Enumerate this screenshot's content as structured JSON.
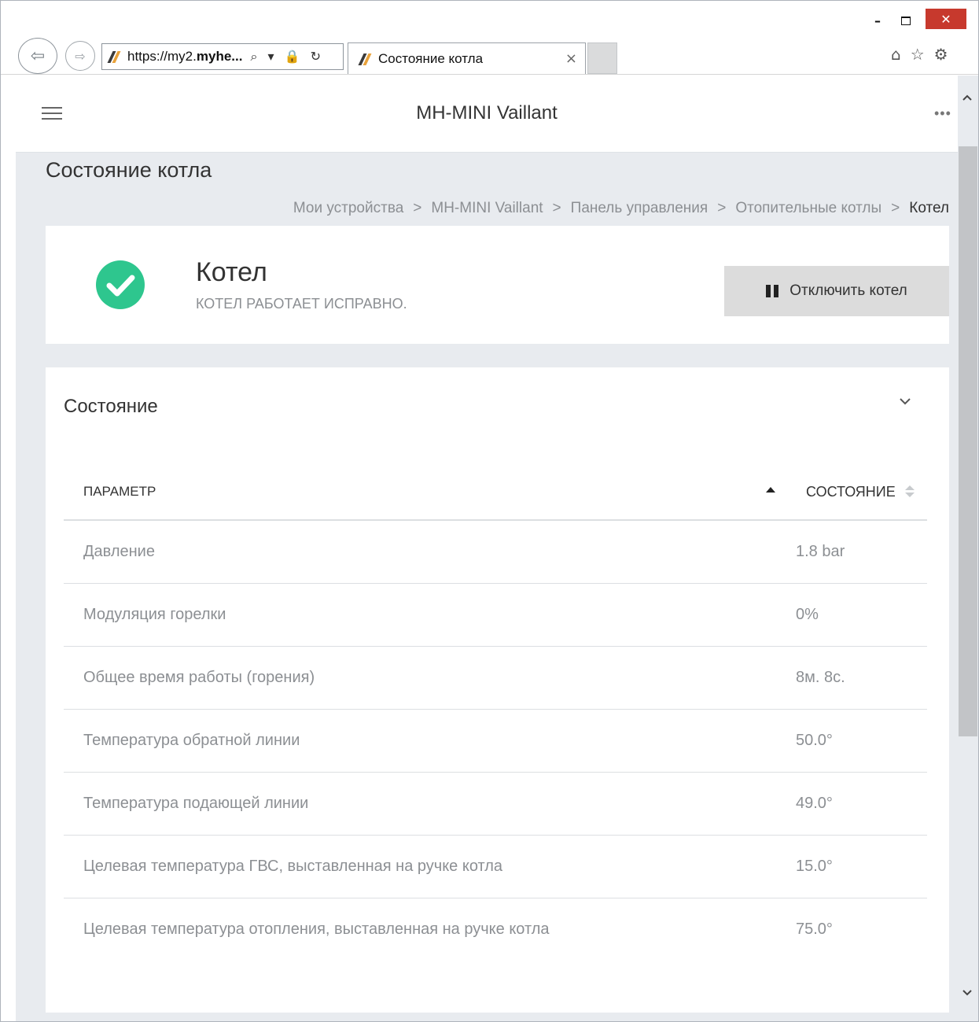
{
  "browser": {
    "window_controls": {
      "minimize": "–",
      "close": "✕"
    },
    "address": {
      "url_prefix": "https://my2.",
      "url_host": "myhe...",
      "icons": "⌕ ▾ 🔒 ↻"
    },
    "tab": {
      "title": "Состояние котла",
      "close": "×"
    },
    "toolbar": {
      "home": "⌂",
      "favorites": "☆",
      "settings": "⚙"
    }
  },
  "header": {
    "title": "MH-MINI Vaillant",
    "more": "•••"
  },
  "page": {
    "title": "Состояние котла",
    "breadcrumb": [
      "Мои устройства",
      "MH-MINI Vaillant",
      "Панель управления",
      "Отопительные котлы",
      "Котел"
    ],
    "breadcrumb_separator": ">"
  },
  "status": {
    "name": "Котел",
    "message": "КОТЕЛ РАБОТАЕТ ИСПРАВНО.",
    "state_color": "#2ec68e",
    "button_label": "Отключить котел"
  },
  "state_section": {
    "title": "Состояние",
    "columns": [
      "ПАРАМЕТР",
      "СОСТОЯНИЕ"
    ],
    "rows": [
      {
        "param": "Давление",
        "value": "1.8 bar"
      },
      {
        "param": "Модуляция горелки",
        "value": "0%"
      },
      {
        "param": "Общее время работы (горения)",
        "value": "8м. 8с."
      },
      {
        "param": "Температура обратной линии",
        "value": "50.0°"
      },
      {
        "param": "Температура подающей линии",
        "value": "49.0°"
      },
      {
        "param": "Целевая температура ГВС, выставленная на ручке котла",
        "value": "15.0°"
      },
      {
        "param": "Целевая температура отопления, выставленная на ручке котла",
        "value": "75.0°"
      }
    ]
  }
}
